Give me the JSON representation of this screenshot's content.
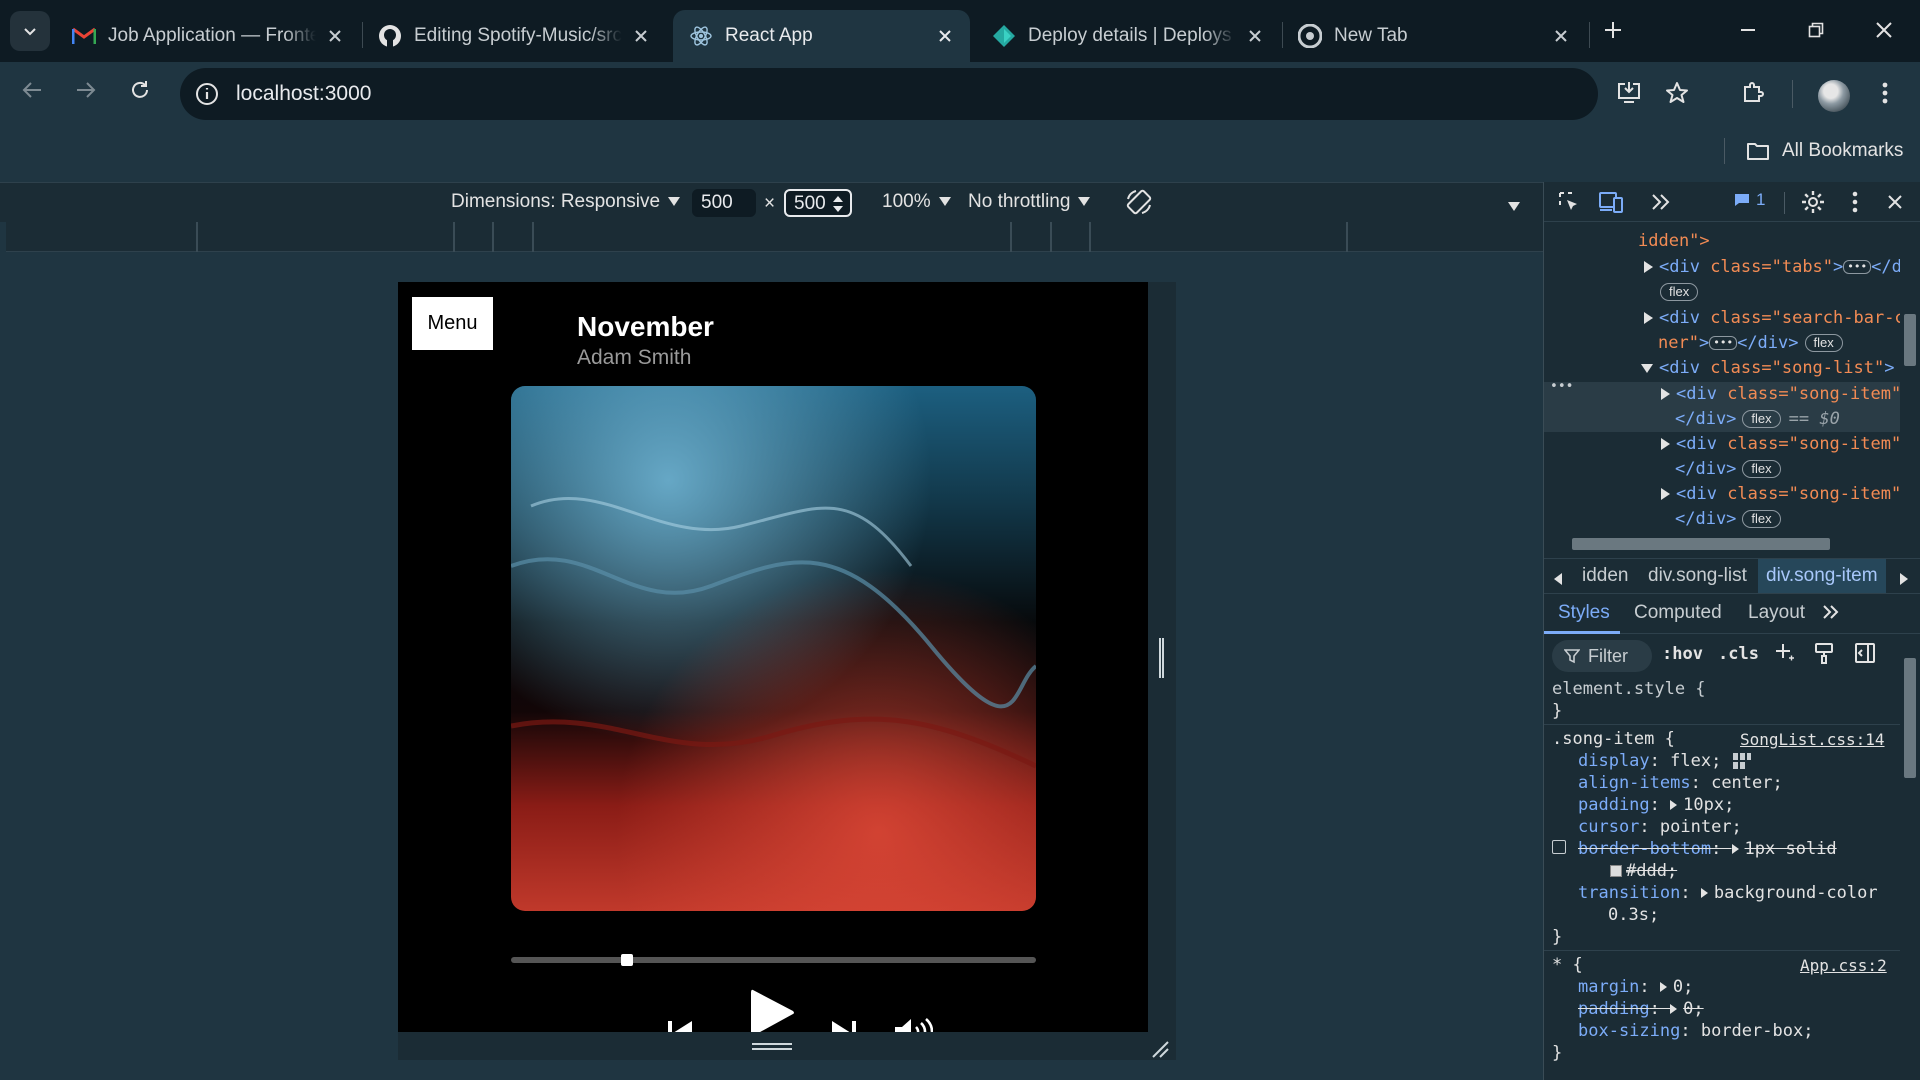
{
  "browser": {
    "tabs": [
      {
        "title": "Job Application — Frontend Developer",
        "favicon": "gmail-icon",
        "active": false
      },
      {
        "title": "Editing Spotify-Music/src",
        "favicon": "github-icon",
        "active": false
      },
      {
        "title": "React App",
        "favicon": "react-icon",
        "active": true
      },
      {
        "title": "Deploy details | Deploys | ",
        "favicon": "netlify-icon",
        "active": false
      },
      {
        "title": "New Tab",
        "favicon": "chrome-icon",
        "active": false
      }
    ],
    "address": "localhost:3000",
    "bookmarks": {
      "all_label": "All Bookmarks"
    }
  },
  "device_toolbar": {
    "dimensions_label": "Dimensions: Responsive",
    "width": "500",
    "height": "500",
    "times": "×",
    "zoom": "100%",
    "throttling": "No throttling"
  },
  "app": {
    "menu_label": "Menu",
    "song_title": "November",
    "artist": "Adam Smith",
    "progress_fraction": 0.22,
    "controls": {
      "more": "•••"
    }
  },
  "devtools": {
    "issues_count": "1",
    "elements": [
      {
        "pre": "",
        "text": "idden\">"
      },
      {
        "class": "tabs",
        "children": "…",
        "badge": "flex"
      },
      {
        "class": "search-bar-container",
        "badge": "flex"
      },
      {
        "class": "song-list"
      },
      {
        "class": "song-item",
        "badge": "flex",
        "selected_marker": "== $0"
      },
      {
        "class": "song-item",
        "badge": "flex"
      },
      {
        "class": "song-item",
        "badge": "flex"
      }
    ],
    "element_lines": {
      "l0": "idden\">",
      "l1_tag": "<div ",
      "l1_attr": "class=",
      "l1_val": "\"tabs\"",
      "l1_close": ">",
      "l1_end": "</di",
      "l2_tag": "<div ",
      "l2_attr": "class=",
      "l2_val": "\"search-bar-c",
      "l2b_val": "ner\"",
      "l2b_close": ">",
      "l2b_end": "</div>",
      "l3_tag": "<div ",
      "l3_attr": "class=",
      "l3_val": "\"song-list\"",
      "l3_close": ">",
      "item_tag": "<div ",
      "item_attr": "class=",
      "item_val": "\"song-item\"",
      "item_close": ":",
      "item_end": "</div>",
      "flex": "flex",
      "selected_marker": "== $0",
      "dots": "•••"
    },
    "breadcrumbs": [
      "idden",
      "div.song-list",
      "div.song-item"
    ],
    "panel_tabs": [
      "Styles",
      "Computed",
      "Layout"
    ],
    "styles_toolbar": {
      "filter": "Filter",
      "hov": ":hov",
      "cls": ".cls"
    },
    "styles": {
      "element_style": "element.style {",
      "close": "}",
      "rule1_selector": ".song-item {",
      "rule1_source": "SongList.css:14",
      "rule1_props": [
        {
          "name": "display",
          "value": "flex;"
        },
        {
          "name": "align-items",
          "value": "center;"
        },
        {
          "name": "padding",
          "value": "10px;"
        },
        {
          "name": "cursor",
          "value": "pointer;"
        },
        {
          "name": "border-bottom",
          "value": "1px solid"
        },
        {
          "name": "",
          "value": "#ddd;"
        },
        {
          "name": "transition",
          "value": "background-color"
        },
        {
          "name": "",
          "value": "0.3s;"
        }
      ],
      "rule2_selector": "* {",
      "rule2_source": "App.css:2",
      "rule2_props": [
        {
          "name": "margin",
          "value": "0;"
        },
        {
          "name": "padding",
          "value": "0;"
        },
        {
          "name": "box-sizing",
          "value": "border-box;"
        }
      ]
    }
  },
  "colors": {
    "accent": "#7cacf8",
    "page_bg": "#1f3541",
    "tab_bg": "#0e1b23"
  }
}
